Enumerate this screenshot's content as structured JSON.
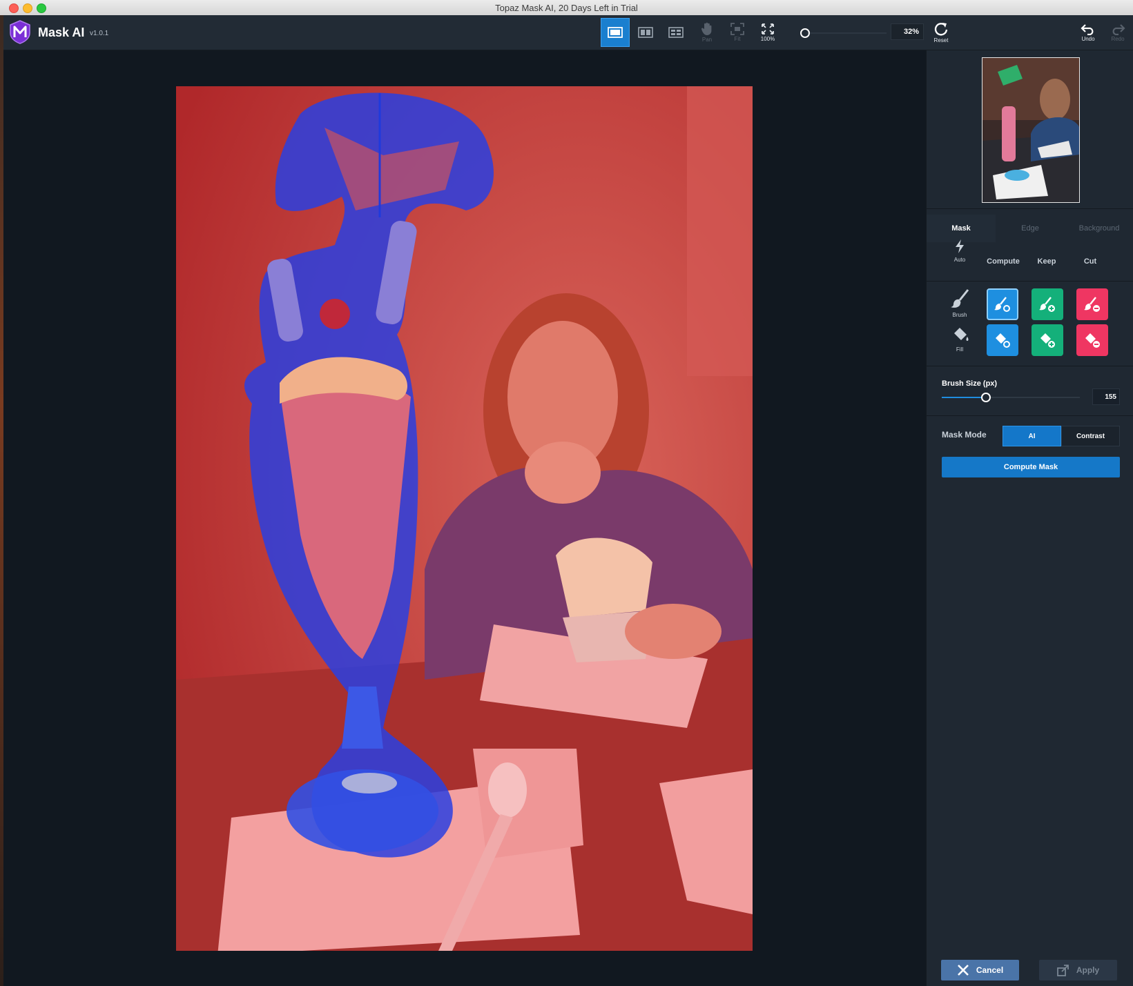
{
  "window": {
    "title": "Topaz Mask AI, 20 Days Left in Trial"
  },
  "app": {
    "name": "Mask AI",
    "version": "v1.0.1"
  },
  "toolbar": {
    "pan_label": "Pan",
    "fit_label": "Fit",
    "zoom100_label": "100%",
    "zoom_value": "32%",
    "reset_label": "Reset",
    "undo_label": "Undo",
    "redo_label": "Redo"
  },
  "panel": {
    "tabs": [
      "Mask",
      "Edge",
      "Background"
    ],
    "columns": {
      "auto": "Auto",
      "compute": "Compute",
      "keep": "Keep",
      "cut": "Cut"
    },
    "tools": {
      "brush": "Brush",
      "fill": "Fill"
    },
    "brush_size_label": "Brush Size (px)",
    "brush_size_value": "155",
    "brush_size_level": 0.32,
    "mask_mode_label": "Mask Mode",
    "mask_mode_options": [
      "AI",
      "Contrast"
    ],
    "mask_mode_selected": "AI",
    "compute_mask_label": "Compute Mask",
    "cancel_label": "Cancel",
    "apply_label": "Apply"
  },
  "colors": {
    "accent": "#1a7fcf",
    "compute": "#1e8fe0",
    "keep": "#14b07a",
    "cut": "#ef3662",
    "cut_overlay": "#e0413f",
    "keep_overlay": "#2a3fe0"
  },
  "icons": [
    "single-view-icon",
    "side-by-side-icon",
    "split-view-icon",
    "hand-icon",
    "fit-icon",
    "fullscreen-icon",
    "reset-icon",
    "undo-icon",
    "redo-icon",
    "lightning-icon",
    "brush-icon",
    "fill-bucket-icon",
    "close-icon",
    "apply-icon"
  ]
}
